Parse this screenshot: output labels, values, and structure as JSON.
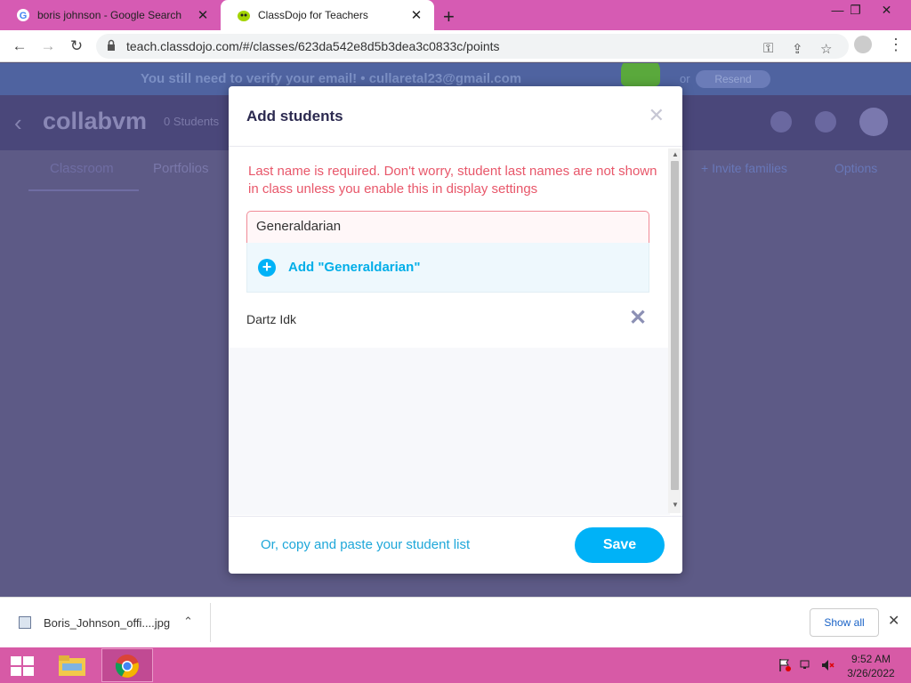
{
  "browser": {
    "tabs": [
      {
        "title": "boris johnson - Google Search",
        "icon": "google-icon"
      },
      {
        "title": "ClassDojo for Teachers",
        "icon": "classdojo-icon"
      }
    ],
    "url": "teach.classdojo.com/#/classes/623da542e8d5b3dea3c0833c/points"
  },
  "page": {
    "banner_text": "You still need to verify your email! • cullaretal23@gmail.com",
    "banner_button": "Resend",
    "banner_or": "or",
    "class_name": "collabvm",
    "student_count": "0 Students",
    "tabs": {
      "classroom": "Classroom",
      "portfolios": "Portfolios"
    },
    "options": {
      "invite": "+ Invite families",
      "options": "Options"
    }
  },
  "modal": {
    "title": "Add students",
    "close_glyph": "✕",
    "error": "Last name is required. Don't worry, student last names are not shown in class unless you enable this in display settings",
    "input_value": "Generaldarian",
    "suggestion": "Add \"Generaldarian\"",
    "students": [
      {
        "name": "Dartz Idk"
      }
    ],
    "paste_link": "Or, copy and paste your student list",
    "save_label": "Save"
  },
  "downloads": {
    "file_name": "Boris_Johnson_offi....jpg",
    "show_all": "Show all"
  },
  "taskbar": {
    "time": "9:52 AM",
    "date": "3/26/2022"
  },
  "colors": {
    "accent": "#00b2f7",
    "error": "#e8576a",
    "tabbar": "#d65bb3",
    "taskbar": "#d75aa6"
  }
}
